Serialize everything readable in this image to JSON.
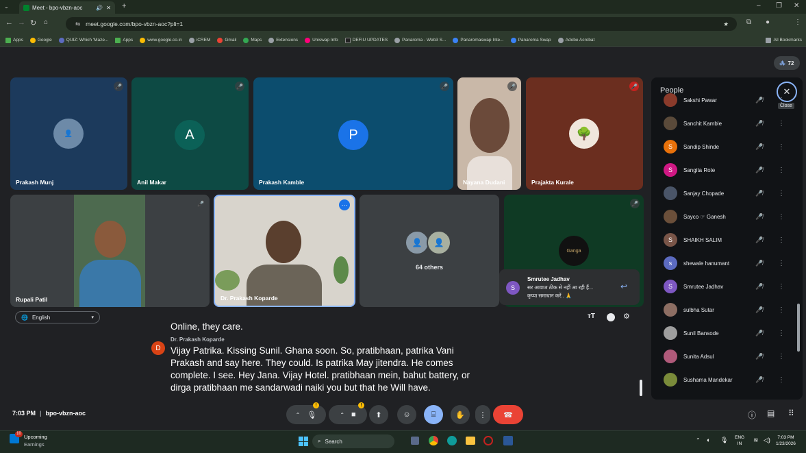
{
  "browser": {
    "tab_title": "Meet - bpo-vbzn-aoc",
    "url": "meet.google.com/bpo-vbzn-aoc?pli=1",
    "bookmarks": [
      "Apps",
      "Google",
      "QUIZ: Which 'Maze...",
      "Apps",
      "www.google.co.in",
      "iCREM",
      "Gmail",
      "Maps",
      "Extensions",
      "Uniswap Info",
      "DEFIU UPDATES",
      "Panaroma - Web3 S...",
      "Panaromaswap Inte...",
      "Panaroma Swap",
      "Adobe Acrobat"
    ],
    "all_bookmarks": "All Bookmarks"
  },
  "meeting": {
    "participant_count": "72",
    "tiles": [
      {
        "name": "Prakash Munj"
      },
      {
        "name": "Anil Makar",
        "initial": "A"
      },
      {
        "name": "Prakash Kamble",
        "initial": "P"
      },
      {
        "name": "Nayana Dudani"
      },
      {
        "name": "Prajakta Kurale"
      },
      {
        "name": "Rupali Patil"
      },
      {
        "name": "Dr. Prakash Koparde"
      },
      {
        "name": "64 others"
      },
      {
        "name": "Ganga"
      }
    ],
    "caption_language": "English",
    "caption_prev": "Online, they care.",
    "caption_speaker": "Dr. Prakash Koparde",
    "caption_speaker_initial": "D",
    "caption_lines": [
      "Vijay Patrika. Kissing Sunil. Ghana soon. So, pratibhaan, patrika Vani",
      "Prakash and say here. They could. Is patrika May jitendra. He comes",
      "complete. I see. Hey Jana. Vijay Hotel. pratibhaan mein, bahut battery, or",
      "dirga pratibhaan me sandarwadi naiki you but that he Will have."
    ],
    "chat_popup": {
      "name": "Smrutee Jadhav",
      "initial": "S",
      "line1": "सर आवाज ठीक से नहीं आ रही हैं...",
      "line2": "कृप्या समाधान करें.. 🙏"
    },
    "time": "7:03 PM",
    "meeting_code": "bpo-vbzn-aoc"
  },
  "people_panel": {
    "title": "People",
    "close_label": "Close",
    "people": [
      {
        "name": "Sakshi Pawar",
        "initial": "",
        "color": "#8a3b2b"
      },
      {
        "name": "Sanchit Kamble",
        "initial": "",
        "color": "#5a4a3a"
      },
      {
        "name": "Sandip Shinde",
        "initial": "S",
        "color": "#e8710a"
      },
      {
        "name": "Sangita Rote",
        "initial": "S",
        "color": "#d01884"
      },
      {
        "name": "Sanjay Chopade",
        "initial": "",
        "color": "#4a5568"
      },
      {
        "name": "Sayco ☞ Ganesh",
        "initial": "",
        "color": "#6b4f3a"
      },
      {
        "name": "SHAIKH SALIM",
        "initial": "S",
        "color": "#795548"
      },
      {
        "name": "shewale hanumant",
        "initial": "s",
        "color": "#5c6bc0"
      },
      {
        "name": "Smrutee Jadhav",
        "initial": "S",
        "color": "#7e57c2"
      },
      {
        "name": "sulbha Sutar",
        "initial": "",
        "color": "#8d6e63"
      },
      {
        "name": "Sunil Bansode",
        "initial": "",
        "color": "#9e9e9e"
      },
      {
        "name": "Sunita Adsul",
        "initial": "",
        "color": "#b05a7a"
      },
      {
        "name": "Sushama Mandekar",
        "initial": "",
        "color": "#7a8b3a"
      }
    ]
  },
  "taskbar": {
    "upcoming": "Upcoming",
    "earnings": "Earnings",
    "badge": "10",
    "search": "Search",
    "lang1": "ENG",
    "lang2": "IN",
    "time": "7:03 PM",
    "date": "1/23/2026"
  }
}
